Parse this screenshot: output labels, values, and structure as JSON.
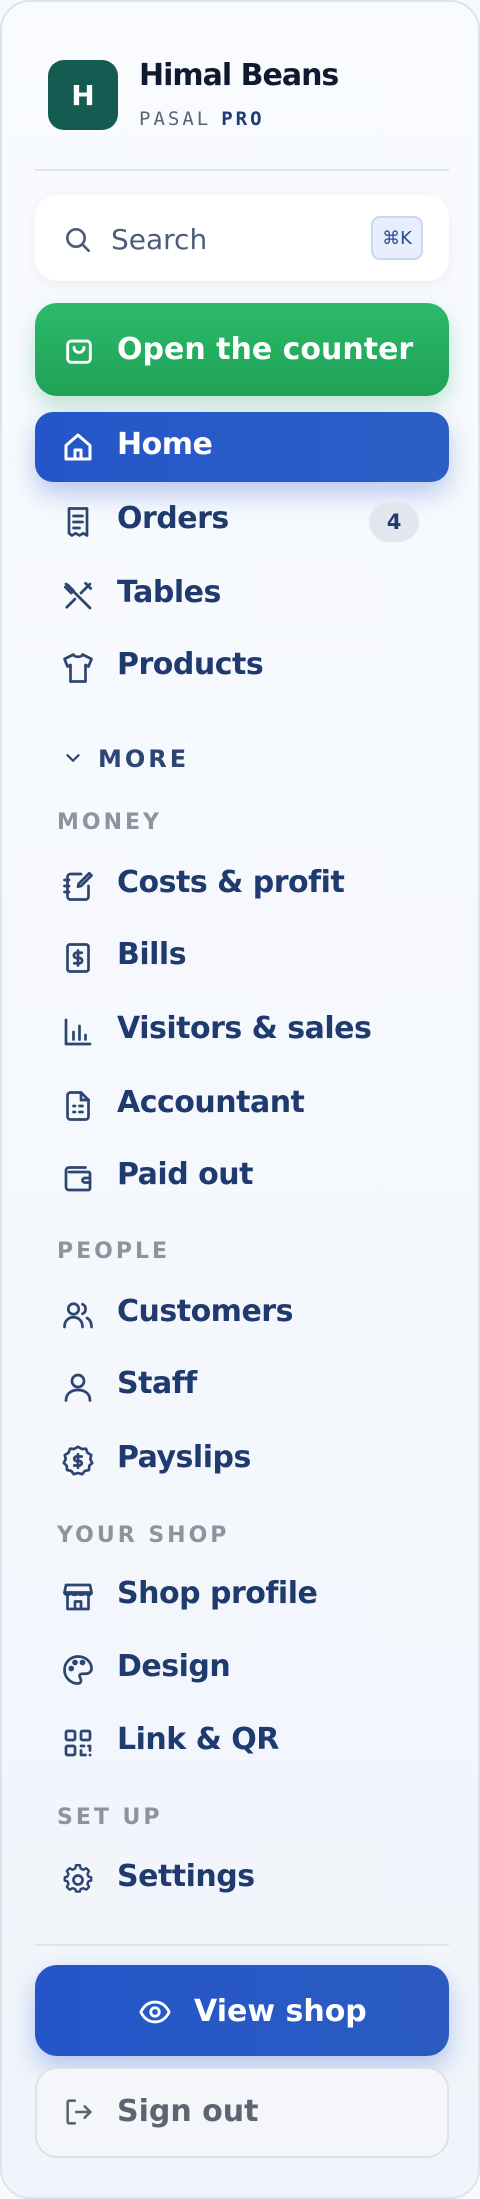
{
  "brand": {
    "logo_letter": "H",
    "name": "Himal Beans",
    "sub": "PASAL",
    "tier": "PRO"
  },
  "search": {
    "placeholder": "Search",
    "shortcut": "⌘K"
  },
  "counter": {
    "label": "Open the counter"
  },
  "nav": {
    "home": "Home",
    "orders": "Orders",
    "orders_badge": "4",
    "tables": "Tables",
    "products": "Products"
  },
  "more": {
    "label": "MORE"
  },
  "money": {
    "title": "MONEY",
    "costs": "Costs & profit",
    "bills": "Bills",
    "visitors": "Visitors & sales",
    "accountant": "Accountant",
    "paid_out": "Paid out"
  },
  "people": {
    "title": "PEOPLE",
    "customers": "Customers",
    "staff": "Staff",
    "payslips": "Payslips"
  },
  "your_shop": {
    "title": "YOUR SHOP",
    "profile": "Shop profile",
    "design": "Design",
    "link_qr": "Link & QR"
  },
  "setup": {
    "title": "SET UP",
    "settings": "Settings"
  },
  "footer": {
    "view_shop": "View shop",
    "sign_out": "Sign out"
  },
  "colors": {
    "accent_blue": "#2456c9",
    "accent_green": "#22a85c",
    "brand_teal": "#145b52",
    "text_navy": "#1f3a6e"
  }
}
